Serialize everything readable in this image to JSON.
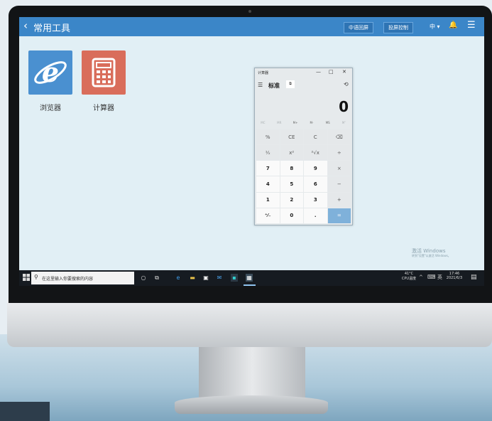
{
  "screen": {
    "header": {
      "back_icon": "‹",
      "title": "常用工具",
      "btn_signal": "中语回屏",
      "btn_projection": "投屏控制",
      "volume_label": "中 ▾",
      "notification_icon": "🔔",
      "menu_icon": "☰"
    },
    "apps": [
      {
        "label": "浏览器",
        "icon": "ie-icon",
        "color": "#4a90d0"
      },
      {
        "label": "计算器",
        "icon": "calculator-icon",
        "color": "#d96d5b"
      }
    ],
    "calculator": {
      "title": "计算器",
      "controls": {
        "minimize": "—",
        "maximize": "□",
        "close": "✕"
      },
      "hamburger": "☰",
      "mode": "标准",
      "mode_icon": "⧉",
      "history_icon": "⟲",
      "display": "0",
      "memory": [
        "MC",
        "MR",
        "M+",
        "M-",
        "MS",
        "M˅"
      ],
      "keys": [
        "%",
        "CE",
        "C",
        "⌫",
        "¹⁄ₓ",
        "x²",
        "²√x",
        "÷",
        "7",
        "8",
        "9",
        "×",
        "4",
        "5",
        "6",
        "−",
        "1",
        "2",
        "3",
        "+",
        "⁺⁄₋",
        "0",
        ".",
        "="
      ]
    },
    "watermark": {
      "line1": "激活 Windows",
      "line2": "转到\"设置\"以激活 Windows。"
    },
    "taskbar": {
      "search_placeholder": "在这里输入你要搜索的内容",
      "temperature": "41°C",
      "temperature_sub": "CPU温度",
      "tray_up": "^",
      "ime": "英",
      "time": "17:46",
      "date": "2021/6/3"
    }
  },
  "colors": {
    "header": "#3b86c8",
    "accent_equals": "#7fb1da",
    "taskbar": "#161b21"
  }
}
